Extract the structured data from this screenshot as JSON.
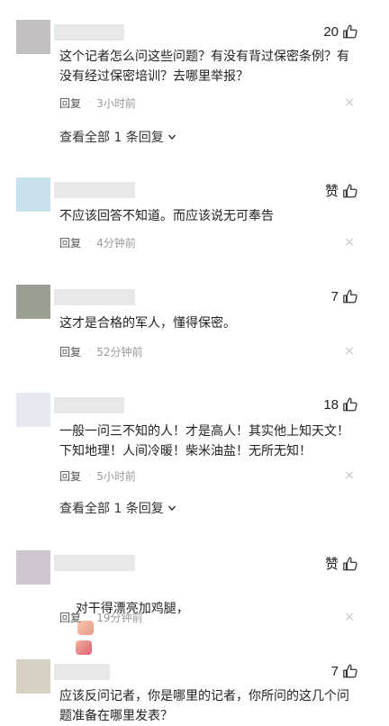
{
  "ui": {
    "reply_label": "回复",
    "view_all_label": "查看全部 1 条回复",
    "close_symbol": "×"
  },
  "comments": [
    {
      "likes": "20",
      "text": "这个记者怎么问这些问题？有没有背过保密条例？有没有经过保密培训？去哪里举报？",
      "time": "3小时前",
      "avatar_color": "#c2bfc0"
    },
    {
      "likes": "赞",
      "text": "不应该回答不知道。而应该说无可奉告",
      "time": "4分钟前",
      "avatar_color": "#c7e2ec"
    },
    {
      "likes": "7",
      "text": "这才是合格的军人，懂得保密。",
      "time": "52分钟前",
      "avatar_color": "#9b9e93"
    },
    {
      "likes": "18",
      "text": "一般一问三不知的人！才是高人！其实他上知天文！下知地理！人间冷暖！柴米油盐！无所无知！",
      "time": "5小时前",
      "avatar_color": "#e6eaf0"
    },
    {
      "likes": "赞",
      "text": "对干得漂亮加鸡腿，",
      "time": "19分钟前",
      "avatar_color": "#cdc6cf"
    },
    {
      "likes": "7",
      "text": "应该反问记者，你是哪里的记者，你所问的这几个问题准备在哪里发表？",
      "avatar_color": "#d6d0c5"
    }
  ]
}
